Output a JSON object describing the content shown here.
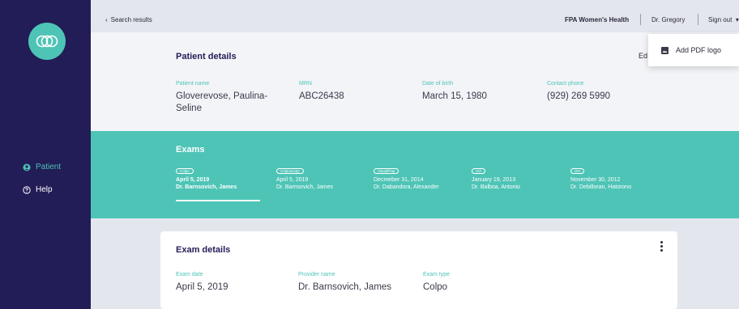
{
  "colors": {
    "sidebar": "#221c57",
    "accent": "#4ec4b6",
    "page_bg": "#e4e6ee"
  },
  "topbar": {
    "back_label": "Search results",
    "org_name": "FPA Women's Health",
    "user_name": "Dr. Gregory",
    "signout_label": "Sign out"
  },
  "sidebar": {
    "items": [
      {
        "label": "Patient",
        "icon": "person-icon",
        "active": true
      },
      {
        "label": "Help",
        "icon": "help-icon",
        "active": false
      }
    ]
  },
  "patient": {
    "title": "Patient details",
    "edit_label": "Ed",
    "fields": [
      {
        "label": "Patient name",
        "value": "Gloverevose, Paulina-Seline"
      },
      {
        "label": "MRN",
        "value": "ABC26438"
      },
      {
        "label": "Date of birth",
        "value": "March 15, 1980"
      },
      {
        "label": "Contact phone",
        "value": "(929) 269 5990"
      }
    ]
  },
  "exams": {
    "title": "Exams",
    "tabs": [
      {
        "type": "Colpo",
        "date": "April 5, 2019",
        "provider": "Dr. Barnsovich, James",
        "active": true
      },
      {
        "type": "Colposcopy",
        "date": "April 5, 2019",
        "provider": "Dr. Barnsovich, James",
        "active": false
      },
      {
        "type": "Visual/Pap",
        "date": "Decmeber 31, 2014",
        "provider": "Dr. Dabandora, Alexander",
        "active": false
      },
      {
        "type": "VIA",
        "date": "January 19, 2013",
        "provider": "Dr. Balboa, Antonio",
        "active": false
      },
      {
        "type": "VIA",
        "date": "November 30, 2012",
        "provider": "Dr. Debilloran, Hatorono",
        "active": false
      }
    ]
  },
  "exam_details": {
    "title": "Exam details",
    "fields": [
      {
        "label": "Exam date",
        "value": "April 5, 2019"
      },
      {
        "label": "Provider name",
        "value": "Dr. Barnsovich, James"
      },
      {
        "label": "Exam type",
        "value": "Colpo"
      }
    ]
  },
  "menu": {
    "items": [
      {
        "label": "Add PDF logo",
        "icon": "image-icon"
      }
    ]
  }
}
